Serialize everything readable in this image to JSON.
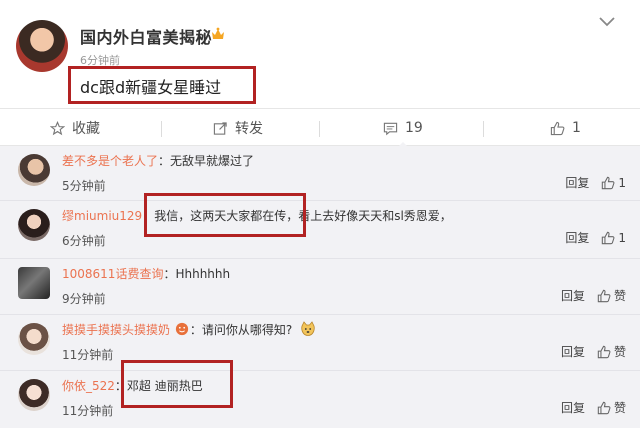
{
  "post": {
    "author": "国内外白富美揭秘",
    "time": "6分钟前",
    "text": "dc跟d新疆女星睡过"
  },
  "actions": {
    "favorite_label": "收藏",
    "repost_label": "转发",
    "comments_count": "19",
    "likes_count": "1"
  },
  "comments": [
    {
      "user": "差不多是个老人了",
      "sep": "：",
      "text": "无敌早就爆过了",
      "time": "5分钟前",
      "reply": "回复",
      "like": "1"
    },
    {
      "user": "缪miumiu129",
      "sep": "：",
      "text": "我信，这两天大家都在传，看上去好像天天和sl秀恩爱，",
      "time": "6分钟前",
      "reply": "回复",
      "like": "1"
    },
    {
      "user": "1008611话费查询",
      "sep": "：",
      "text": "Hhhhhhh",
      "time": "9分钟前",
      "reply": "回复",
      "like": "赞"
    },
    {
      "user": "摸摸手摸摸头摸摸奶",
      "sep": "：",
      "text": "请问你从哪得知?",
      "time": "11分钟前",
      "reply": "回复",
      "like": "赞"
    },
    {
      "user": "你依_522",
      "sep": "：",
      "text": "邓超 迪丽热巴",
      "time": "11分钟前",
      "reply": "回复",
      "like": "赞"
    }
  ],
  "colors": {
    "username": "#eb7350",
    "highlight": "#b22222",
    "comment_bg": "#f2f2f5"
  },
  "icons": [
    "chevron-down-icon",
    "star-icon",
    "repost-icon",
    "comment-icon",
    "thumb-up-icon",
    "vip-badge-icon",
    "emoji-icon"
  ]
}
